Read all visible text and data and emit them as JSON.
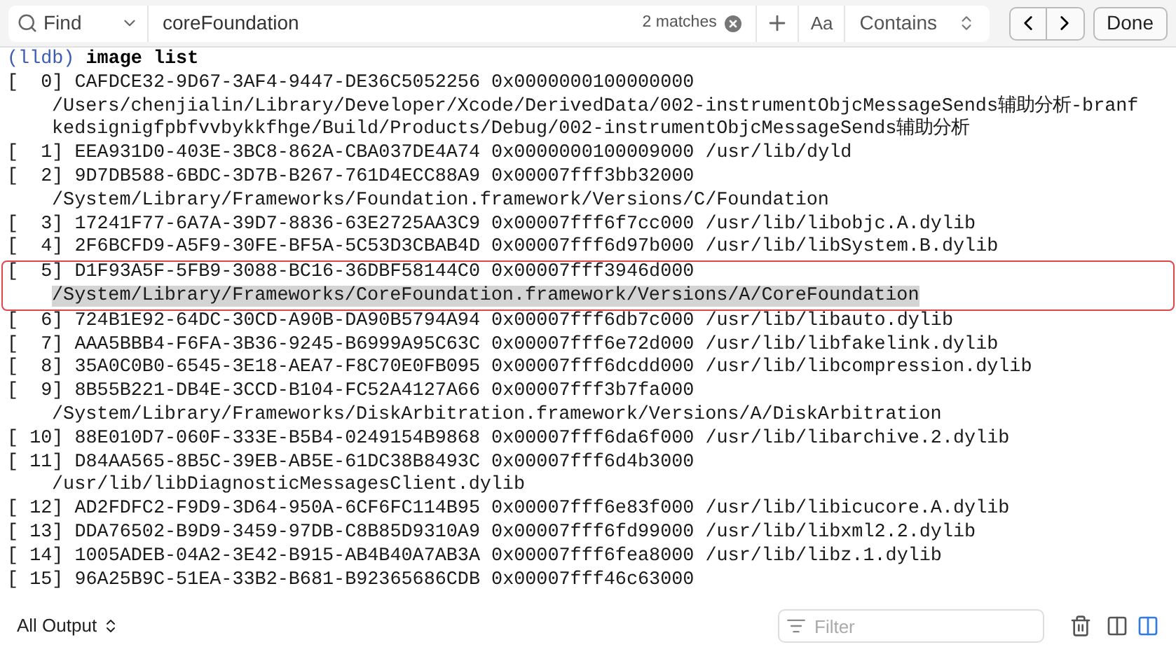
{
  "find_bar": {
    "mode": "Find",
    "query": "coreFoundation",
    "match_count": "2 matches",
    "case_toggle": "Aa",
    "match_type": "Contains",
    "done": "Done"
  },
  "console": {
    "prompt": "(lldb)",
    "command": "image list",
    "entries": [
      {
        "line": "[  0] CAFDCE32-9D67-3AF4-9447-DE36C5052256 0x0000000100000000",
        "continuation": [
          "/Users/chenjialin/Library/Developer/Xcode/DerivedData/002-instrumentObjcMessageSends辅助分析-branf",
          "kedsignigfpbfvvbykkfhge/Build/Products/Debug/002-instrumentObjcMessageSends辅助分析"
        ],
        "highlighted": false
      },
      {
        "line": "[  1] EEA931D0-403E-3BC8-862A-CBA037DE4A74 0x0000000100009000 /usr/lib/dyld",
        "highlighted": false
      },
      {
        "line": "[  2] 9D7DB588-6BDC-3D7B-B267-761D4ECC88A9 0x00007fff3bb32000",
        "continuation": [
          "/System/Library/Frameworks/Foundation.framework/Versions/C/Foundation"
        ],
        "highlighted": false
      },
      {
        "line": "[  3] 17241F77-6A7A-39D7-8836-63E2725AA3C9 0x00007fff6f7cc000 /usr/lib/libobjc.A.dylib",
        "highlighted": false
      },
      {
        "line": "[  4] 2F6BCFD9-A5F9-30FE-BF5A-5C53D3CBAB4D 0x00007fff6d97b000 /usr/lib/libSystem.B.dylib",
        "highlighted": false
      },
      {
        "line": "[  5] D1F93A5F-5FB9-3088-BC16-36DBF58144C0 0x00007fff3946d000",
        "continuation": [
          "/System/Library/Frameworks/CoreFoundation.framework/Versions/A/CoreFoundation"
        ],
        "highlighted": true
      },
      {
        "line": "[  6] 724B1E92-64DC-30CD-A90B-DA90B5794A94 0x00007fff6db7c000 /usr/lib/libauto.dylib",
        "highlighted": false
      },
      {
        "line": "[  7] AAA5BBB4-F6FA-3B36-9245-B6999A95C63C 0x00007fff6e72d000 /usr/lib/libfakelink.dylib",
        "highlighted": false
      },
      {
        "line": "[  8] 35A0C0B0-6545-3E18-AEA7-F8C70E0FB095 0x00007fff6dcdd000 /usr/lib/libcompression.dylib",
        "highlighted": false
      },
      {
        "line": "[  9] 8B55B221-DB4E-3CCD-B104-FC52A4127A66 0x00007fff3b7fa000",
        "continuation": [
          "/System/Library/Frameworks/DiskArbitration.framework/Versions/A/DiskArbitration"
        ],
        "highlighted": false
      },
      {
        "line": "[ 10] 88E010D7-060F-333E-B5B4-0249154B9868 0x00007fff6da6f000 /usr/lib/libarchive.2.dylib",
        "highlighted": false
      },
      {
        "line": "[ 11] D84AA565-8B5C-39EB-AB5E-61DC38B8493C 0x00007fff6d4b3000",
        "continuation": [
          "/usr/lib/libDiagnosticMessagesClient.dylib"
        ],
        "highlighted": false
      },
      {
        "line": "[ 12] AD2FDFC2-F9D9-3D64-950A-6CF6FC114B95 0x00007fff6e83f000 /usr/lib/libicucore.A.dylib",
        "highlighted": false
      },
      {
        "line": "[ 13] DDA76502-B9D9-3459-97DB-C8B85D9310A9 0x00007fff6fd99000 /usr/lib/libxml2.2.dylib",
        "highlighted": false
      },
      {
        "line": "[ 14] 1005ADEB-04A2-3E42-B915-AB4B40A7AB3A 0x00007fff6fea8000 /usr/lib/libz.1.dylib",
        "highlighted": false
      },
      {
        "line": "[ 15] 96A25B9C-51EA-33B2-B681-B92365686CDB 0x00007fff46c63000",
        "highlighted": false
      }
    ]
  },
  "bottom_bar": {
    "output_selector": "All Output",
    "filter": {
      "placeholder": "Filter"
    }
  }
}
